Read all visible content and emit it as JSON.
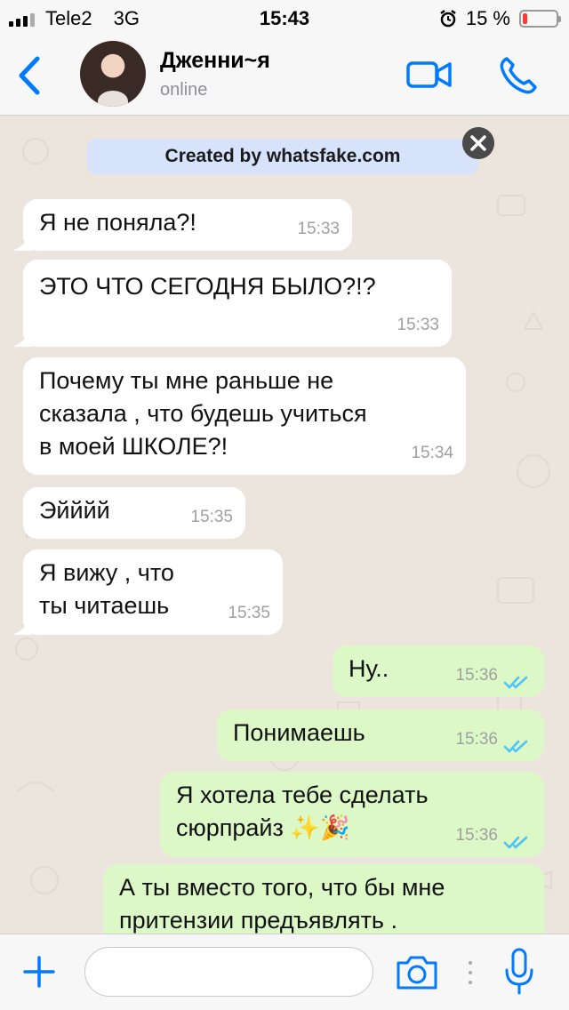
{
  "status_bar": {
    "carrier": "Tele2",
    "network": "3G",
    "time": "15:43",
    "battery_percent": "15 %",
    "battery_level": 0.15
  },
  "header": {
    "contact_name": "Дженни~я",
    "contact_status": "online"
  },
  "banner": {
    "text": "Created by whatsfake.com"
  },
  "messages": [
    {
      "dir": "in",
      "text": "Я не поняла?!",
      "time": "15:33"
    },
    {
      "dir": "in",
      "text": "ЭТО ЧТО СЕГОДНЯ БЫЛО?!?",
      "time": "15:33"
    },
    {
      "dir": "in",
      "text": "Почему ты мне раньше не\nсказала , что будешь учиться\nв моей ШКОЛЕ?!",
      "time": "15:34"
    },
    {
      "dir": "in",
      "text": "Эйййй",
      "time": "15:35"
    },
    {
      "dir": "in",
      "text": "Я вижу , что\nты читаешь",
      "time": "15:35"
    },
    {
      "dir": "out",
      "text": "Ну..",
      "time": "15:36",
      "read": true
    },
    {
      "dir": "out",
      "text": "Понимаешь",
      "time": "15:36",
      "read": true
    },
    {
      "dir": "out",
      "text": "Я хотела тебе сделать\nсюрпрайз ✨🎉",
      "time": "15:36",
      "read": true
    },
    {
      "dir": "out",
      "text": "А ты вместо того, что бы мне\nпритензии предъявлять .",
      "time": "",
      "read": false
    }
  ],
  "input": {
    "value": "",
    "placeholder": ""
  },
  "colors": {
    "accent": "#007aff",
    "incoming_bubble": "#ffffff",
    "outgoing_bubble": "#dcf8c6",
    "chat_background": "#ece5dd",
    "read_ticks": "#4fc3f7",
    "battery_low": "#ff3b30"
  },
  "icons": {
    "back": "chevron-left-icon",
    "video": "video-camera-icon",
    "call": "phone-icon",
    "close": "close-icon",
    "plus": "plus-icon",
    "camera": "camera-icon",
    "mic": "microphone-icon",
    "alarm": "alarm-clock-icon"
  }
}
